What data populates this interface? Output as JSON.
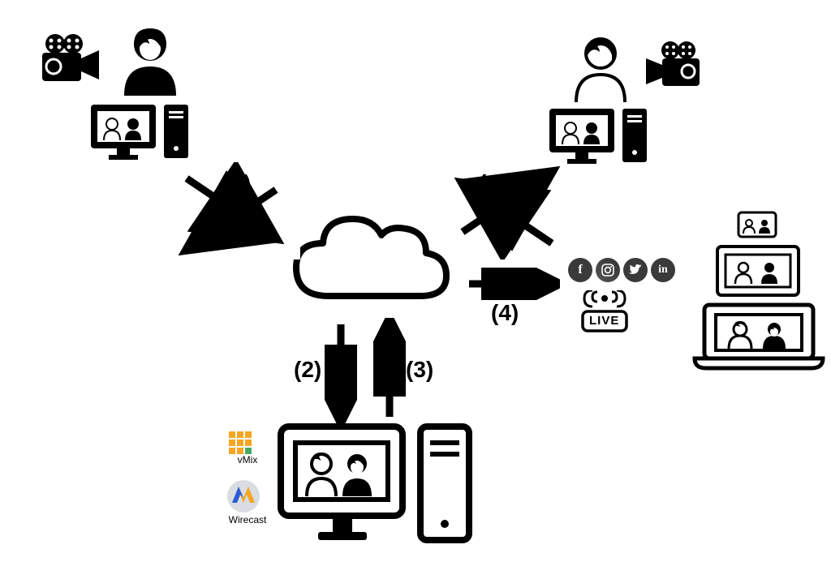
{
  "labels": {
    "arrow1_left": "(1)",
    "arrow1_right": "(1)",
    "arrow2": "(2)",
    "arrow3": "(3)",
    "arrow4": "(4)"
  },
  "software": {
    "vmix": "vMix",
    "wirecast": "Wirecast"
  },
  "live_badge": "LIVE",
  "nodes": {
    "top_left": "participant-station-1",
    "top_right": "participant-station-2",
    "cloud": "cloud-service",
    "bottom": "mixing-station",
    "audience": "viewers-devices",
    "social": "social-outputs"
  }
}
